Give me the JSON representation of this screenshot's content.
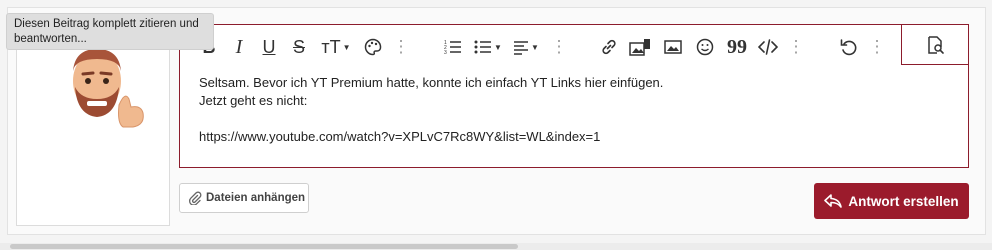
{
  "tooltip": {
    "text": "Diesen Beitrag komplett zitieren und beantworten..."
  },
  "editor": {
    "toolbar": {
      "bold": "B",
      "italic": "I",
      "underline": "U",
      "strike": "S",
      "font_size": "тT",
      "icons": [
        "bold-icon",
        "italic-icon",
        "underline-icon",
        "strikethrough-icon",
        "font-size-icon",
        "palette-icon",
        "ordered-list-icon",
        "bulleted-list-icon",
        "align-icon",
        "link-icon",
        "image-gallery-icon",
        "image-icon",
        "emoji-icon",
        "quote-icon",
        "code-icon",
        "undo-icon",
        "preview-icon"
      ]
    },
    "content": {
      "line1": "Seltsam. Bevor ich YT Premium hatte, konnte ich einfach YT Links hier einfügen.",
      "line2": "Jetzt geht es nicht:",
      "link": "https://www.youtube.com/watch?v=XPLvC7Rc8WY&list=WL&index=1"
    }
  },
  "actions": {
    "attach_label": "Dateien anhängen",
    "reply_label": "Antwort erstellen"
  },
  "colors": {
    "accent": "#9b1b2c",
    "editor_border": "#8c1c2c"
  }
}
